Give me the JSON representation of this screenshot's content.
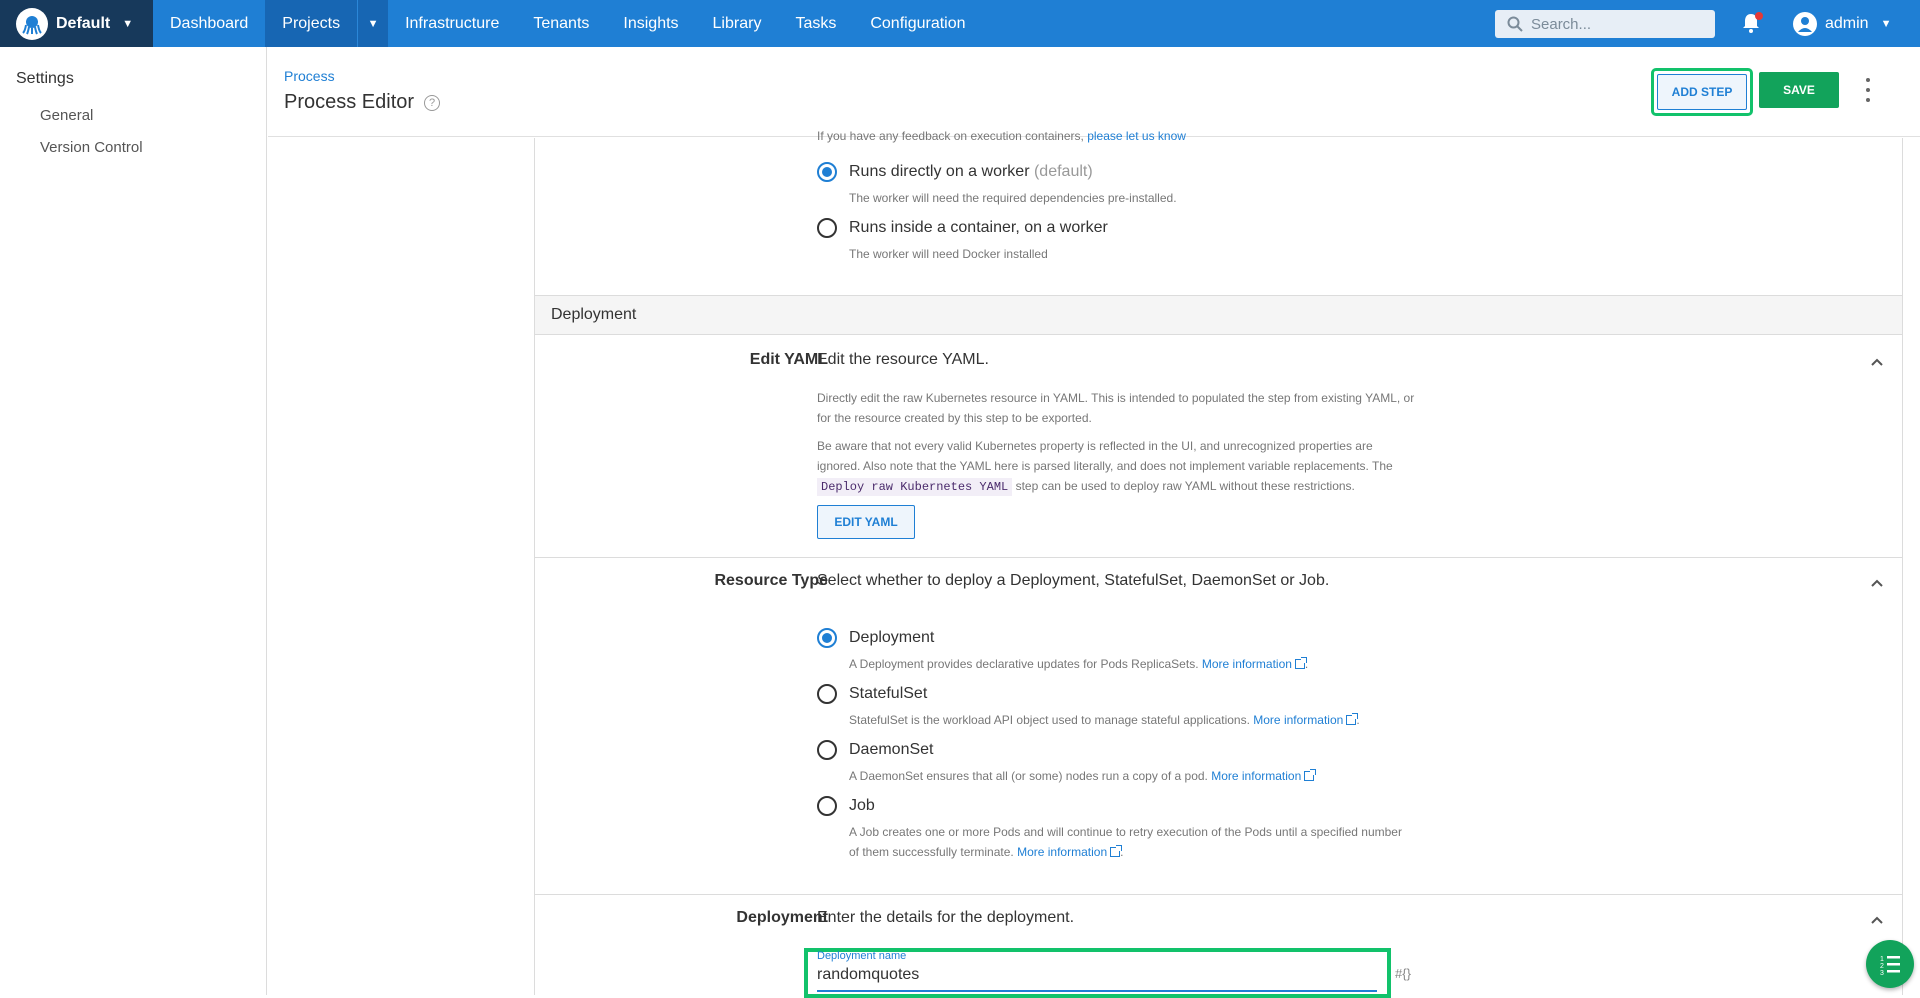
{
  "topbar": {
    "space": "Default",
    "nav": [
      "Dashboard",
      "Projects",
      "Infrastructure",
      "Tenants",
      "Insights",
      "Library",
      "Tasks",
      "Configuration"
    ],
    "search_placeholder": "Search...",
    "user": "admin"
  },
  "sidebar": {
    "title": "Settings",
    "items": [
      "General",
      "Version Control"
    ]
  },
  "header": {
    "breadcrumb": "Process",
    "title": "Process Editor",
    "add_step": "ADD STEP",
    "save": "SAVE"
  },
  "execution": {
    "feedback_text": "If you have any feedback on execution containers,",
    "feedback_link": "please let us know",
    "options": [
      {
        "label": "Runs directly on a worker",
        "suffix": "(default)",
        "desc": "The worker will need the required dependencies pre-installed.",
        "checked": true
      },
      {
        "label": "Runs inside a container, on a worker",
        "suffix": "",
        "desc": "The worker will need Docker installed",
        "checked": false
      }
    ]
  },
  "deployment_section": {
    "title": "Deployment",
    "edit_yaml": {
      "label": "Edit YAML",
      "summary": "Edit the resource YAML.",
      "para1": "Directly edit the raw Kubernetes resource in YAML. This is intended to populated the step from existing YAML, or for the resource created by this step to be exported.",
      "para2_a": "Be aware that not every valid Kubernetes property is reflected in the UI, and unrecognized properties are ignored. Also note that the YAML here is parsed literally, and does not implement variable replacements. The",
      "para2_code": "Deploy raw Kubernetes YAML",
      "para2_b": "step can be used to deploy raw YAML without these restrictions.",
      "button": "EDIT YAML"
    },
    "resource_type": {
      "label": "Resource Type",
      "summary": "Select whether to deploy a Deployment, StatefulSet, DaemonSet or Job.",
      "more_info": "More information",
      "options": [
        {
          "label": "Deployment",
          "desc": "A Deployment provides declarative updates for Pods ReplicaSets.",
          "checked": true
        },
        {
          "label": "StatefulSet",
          "desc": "StatefulSet is the workload API object used to manage stateful applications.",
          "checked": false
        },
        {
          "label": "DaemonSet",
          "desc": "A DaemonSet ensures that all (or some) nodes run a copy of a pod.",
          "checked": false
        },
        {
          "label": "Job",
          "desc": "A Job creates one or more Pods and will continue to retry execution of the Pods until a specified number of them successfully terminate.",
          "checked": false
        }
      ]
    },
    "deployment": {
      "label": "Deployment",
      "summary": "Enter the details for the deployment.",
      "name_label": "Deployment name",
      "name_value": "randomquotes",
      "var_icon": "#{}"
    }
  },
  "colors": {
    "primary": "#1f7fd4",
    "nav_dark": "#17395b",
    "success": "#12a35b",
    "highlight": "#12c26b"
  }
}
